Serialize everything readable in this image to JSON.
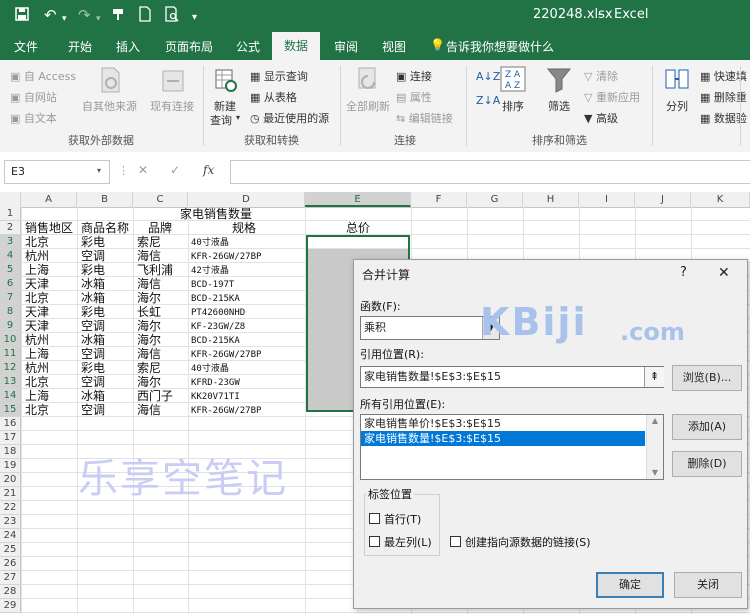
{
  "titlebar": {
    "filename": "220248.xlsx",
    "separator": "-",
    "app": "Excel"
  },
  "tabs": [
    {
      "label": "文件"
    },
    {
      "label": "开始"
    },
    {
      "label": "插入"
    },
    {
      "label": "页面布局"
    },
    {
      "label": "公式"
    },
    {
      "label": "数据"
    },
    {
      "label": "审阅"
    },
    {
      "label": "视图"
    },
    {
      "label": "告诉我你想要做什么"
    }
  ],
  "ribbon": {
    "get_external": {
      "access": "自 Access",
      "web": "自网站",
      "text": "自文本",
      "other": "自其他来源",
      "existing": "现有连接",
      "group": "获取外部数据"
    },
    "transform": {
      "new_query_1": "新建",
      "new_query_2": "查询",
      "show_query": "显示查询",
      "from_table": "从表格",
      "recent": "最近使用的源",
      "group": "获取和转换"
    },
    "connections": {
      "refresh_all": "全部刷新",
      "connections": "连接",
      "properties": "属性",
      "edit_links": "编辑链接",
      "group": "连接"
    },
    "sort_filter": {
      "sort": "排序",
      "filter": "筛选",
      "clear": "清除",
      "reapply": "重新应用",
      "advanced": "高级",
      "group": "排序和筛选"
    },
    "tools": {
      "split": "分列",
      "flash_fill": "快速填",
      "remove_dup": "删除重",
      "validate": "数据验"
    }
  },
  "formula_bar": {
    "name_box": "E3",
    "fx": "fx",
    "cancel": "✕",
    "enter": "✓",
    "value": ""
  },
  "sheet": {
    "columns": [
      "A",
      "B",
      "C",
      "D",
      "E",
      "F",
      "G",
      "H",
      "I",
      "J",
      "K"
    ],
    "rows": [
      "1",
      "2",
      "3",
      "4",
      "5",
      "6",
      "7",
      "8",
      "9",
      "10",
      "11",
      "12",
      "13",
      "14",
      "15",
      "16",
      "17",
      "18",
      "19",
      "20",
      "21",
      "22",
      "23",
      "24",
      "25",
      "26",
      "27",
      "28",
      "29"
    ],
    "title": "家电销售数量",
    "headers": [
      "销售地区",
      "商品名称",
      "品牌",
      "规格",
      "总价"
    ],
    "data": [
      [
        "北京",
        "彩电",
        "索尼",
        "40寸液晶"
      ],
      [
        "杭州",
        "空调",
        "海信",
        "KFR-26GW/27BP"
      ],
      [
        "上海",
        "彩电",
        "飞利浦",
        "42寸液晶"
      ],
      [
        "天津",
        "冰箱",
        "海信",
        "BCD-197T"
      ],
      [
        "北京",
        "冰箱",
        "海尔",
        "BCD-215KA"
      ],
      [
        "天津",
        "彩电",
        "长虹",
        "PT42600NHD"
      ],
      [
        "天津",
        "空调",
        "海尔",
        "KF-23GW/Z8"
      ],
      [
        "杭州",
        "冰箱",
        "海尔",
        "BCD-215KA"
      ],
      [
        "上海",
        "空调",
        "海信",
        "KFR-26GW/27BP"
      ],
      [
        "杭州",
        "彩电",
        "索尼",
        "40寸液晶"
      ],
      [
        "北京",
        "空调",
        "海尔",
        "KFRD-23GW"
      ],
      [
        "上海",
        "冰箱",
        "西门子",
        "KK20V71TI"
      ],
      [
        "北京",
        "空调",
        "海信",
        "KFR-26GW/27BP"
      ]
    ]
  },
  "watermark": {
    "text": "乐享空笔记",
    "site": "KBiji",
    "site_suffix": ".com"
  },
  "dialog": {
    "title": "合并计算",
    "help": "?",
    "close": "✕",
    "function_label": "函数(F):",
    "function_value": "乘积",
    "reference_label": "引用位置(R):",
    "reference_value": "家电销售数量!$E$3:$E$15",
    "browse": "浏览(B)...",
    "all_refs_label": "所有引用位置(E):",
    "all_refs": [
      "家电销售单价!$E$3:$E$15",
      "家电销售数量!$E$3:$E$15"
    ],
    "add": "添加(A)",
    "delete": "删除(D)",
    "labels_group": "标签位置",
    "top_row": "首行(T)",
    "left_col": "最左列(L)",
    "link_source": "创建指向源数据的链接(S)",
    "ok": "确定",
    "close_btn": "关闭"
  }
}
